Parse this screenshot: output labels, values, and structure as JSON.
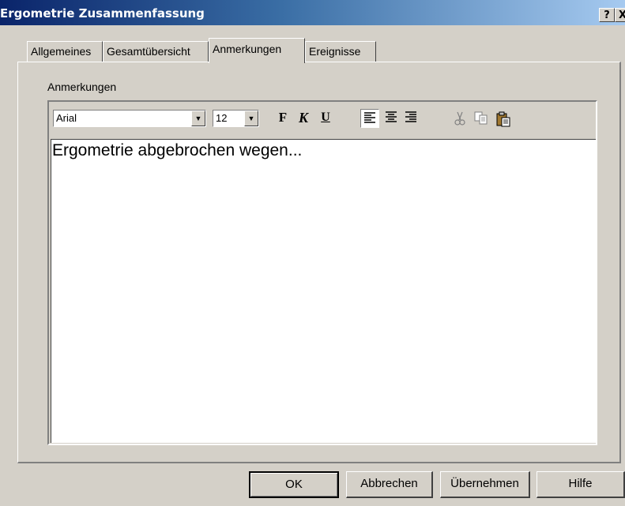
{
  "window": {
    "title": "Ergometrie Zusammenfassung",
    "help_button": "?",
    "close_button": "X"
  },
  "tabs": [
    {
      "label": "Allgemeines",
      "active": false
    },
    {
      "label": "Gesamtübersicht",
      "active": false
    },
    {
      "label": "Anmerkungen",
      "active": true
    },
    {
      "label": "Ereignisse",
      "active": false
    }
  ],
  "panel": {
    "label": "Anmerkungen"
  },
  "editor": {
    "font_select": {
      "value": "Arial"
    },
    "size_select": {
      "value": "12"
    },
    "bold_label": "F",
    "italic_label": "K",
    "underline_label": "U",
    "content": "Ergometrie abgebrochen wegen..."
  },
  "buttons": {
    "ok": "OK",
    "cancel": "Abbrechen",
    "apply": "Übernehmen",
    "help": "Hilfe"
  },
  "colors": {
    "title_bar_start": "#0a246a",
    "title_bar_end": "#a6caf0",
    "dialog_face": "#d4d0c8"
  }
}
